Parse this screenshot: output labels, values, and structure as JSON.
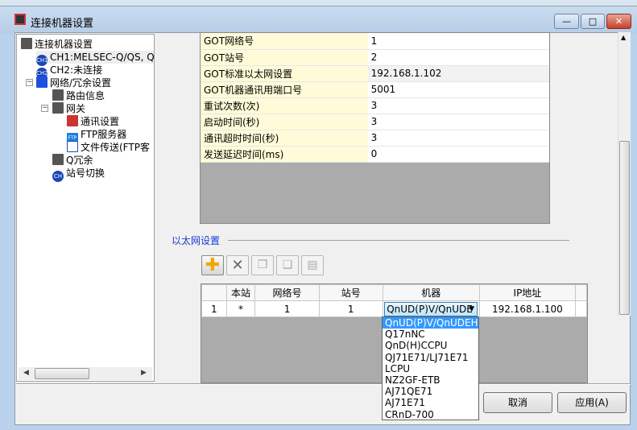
{
  "window": {
    "title": "连接机器设置",
    "minimize": "—",
    "maximize": "□",
    "close": "✕"
  },
  "tree": {
    "items": [
      {
        "label": "连接机器设置",
        "icon": "device-icon"
      },
      {
        "label": "CH1:MELSEC-Q/QS, Q",
        "icon": "ch1-icon",
        "badge": "CH1"
      },
      {
        "label": "CH2:未连接",
        "icon": "ch2-icon",
        "badge": "CH2"
      },
      {
        "label": "网络/冗余设置",
        "icon": "network-icon"
      },
      {
        "label": "路由信息",
        "icon": "routing-icon"
      },
      {
        "label": "网关",
        "icon": "gateway-icon"
      },
      {
        "label": "通讯设置",
        "icon": "comm-settings-icon"
      },
      {
        "label": "FTP服务器",
        "icon": "ftp-server-icon",
        "badge": "FTP"
      },
      {
        "label": "文件传送(FTP客",
        "icon": "file-transfer-icon"
      },
      {
        "label": "Q冗余",
        "icon": "q-redundancy-icon"
      },
      {
        "label": "站号切换",
        "icon": "station-switch-icon",
        "badge": "CH"
      }
    ]
  },
  "properties": [
    {
      "key": "GOT网络号",
      "value": "1"
    },
    {
      "key": "GOT站号",
      "value": "2"
    },
    {
      "key": "GOT标准以太网设置",
      "value": "192.168.1.102"
    },
    {
      "key": "GOT机器通讯用端口号",
      "value": "5001"
    },
    {
      "key": "重试次数(次)",
      "value": "3"
    },
    {
      "key": "启动时间(秒)",
      "value": "3"
    },
    {
      "key": "通讯超时时间(秒)",
      "value": "3"
    },
    {
      "key": "发送延迟时间(ms)",
      "value": "0"
    }
  ],
  "ethernet": {
    "group_label": "以太网设置",
    "toolbar": [
      {
        "icon": "add-icon"
      },
      {
        "icon": "delete-icon"
      },
      {
        "icon": "copy-icon"
      },
      {
        "icon": "copy-paste-icon"
      },
      {
        "icon": "paste-icon"
      }
    ],
    "columns": [
      "",
      "本站",
      "网络号",
      "站号",
      "机器",
      "IP地址",
      ""
    ],
    "rows": [
      {
        "no": "1",
        "host": "*",
        "network": "1",
        "station": "1",
        "device": "QnUD(P)V/QnUDE",
        "ip": "192.168.1.100"
      }
    ],
    "dropdown_options": [
      "QnUD(P)V/QnUDEH",
      "Q17nNC",
      "QnD(H)CCPU",
      "QJ71E71/LJ71E71",
      "LCPU",
      "NZ2GF-ETB",
      "AJ71QE71",
      "AJ71E71",
      "CRnD-700"
    ],
    "selected_option": "QnUD(P)V/QnUDEH"
  },
  "buttons": {
    "cancel": "取消",
    "apply": "应用(A)"
  },
  "colors": {
    "selection": "#3399ff",
    "key_cell": "#fffbd8",
    "group_label": "#1b3bd4"
  }
}
